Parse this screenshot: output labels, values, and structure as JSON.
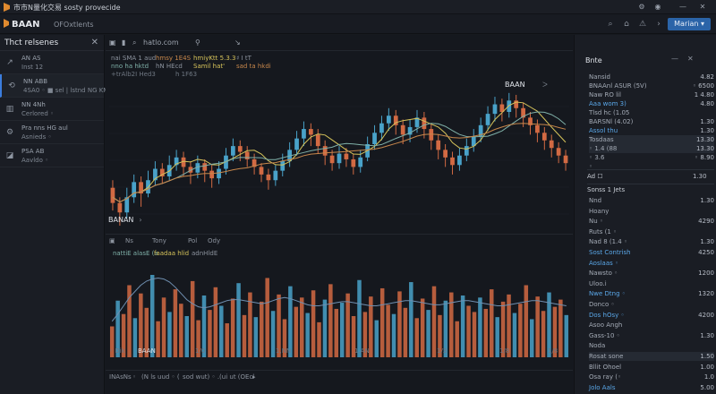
{
  "titlebar": {
    "title": "市市N量化交易 sosty provecide",
    "controls": [
      "⚙",
      "◉",
      "—",
      "✕"
    ]
  },
  "header": {
    "brand": "BAAN",
    "subtitle": "OFOxtlents",
    "right_button": "Marian ▾"
  },
  "left": {
    "panel_title": "Thct relsenes",
    "close": "✕",
    "items": [
      {
        "icon": "↗",
        "l1": "AN AS",
        "l2": "Inst 12"
      },
      {
        "icon": "⟲",
        "l1": "NN ABB",
        "l2": "4SA0 ◦ ■ sel | lstnd NG KMI"
      },
      {
        "icon": "▥",
        "l1": "NN 4Nh",
        "l2": "Cerlored ◦"
      },
      {
        "icon": "⚙",
        "l1": "Pra nns HG aul",
        "l2": "Asnieds ◦"
      },
      {
        "icon": "◪",
        "l1": "PSA AB",
        "l2": "Aavldo ◦"
      }
    ]
  },
  "toolbar": {
    "items": [
      "▣",
      "▮",
      "⌕",
      "hatlo.com",
      "⚲",
      "↘"
    ]
  },
  "indicators": {
    "row1": [
      "nai SMA 1 aud",
      "hmsy 1E4S",
      "hmiyKtt 5.3.3",
      "♯ I tT"
    ],
    "row2": [
      "nno ha hktd",
      "hN HEcd",
      "Samil hat'",
      "sad ta hkdi"
    ],
    "row3": [
      "+trAlb2I Hed3",
      "h 1F63"
    ]
  },
  "chart_symbol": "BAAN",
  "chart_symbol_sub": "ᐳ",
  "main_symbol": "BANAN",
  "sub_toolbar": [
    "▣",
    "Ns",
    "Tony",
    "Pol",
    "Ody"
  ],
  "volume_labels": [
    "nattiE alasE (a",
    "faadaa hlid",
    "adnHldE"
  ],
  "xaxis": [
    "◦ Dik",
    "BAAN",
    "1/0",
    "1,NN",
    "1.AN",
    "1/3",
    "1/8",
    "1/8"
  ],
  "bottom": [
    "INAsNs",
    "◦",
    "(N ls uud ◦ (",
    "sod wut) ◦ .(ui ut (OEcl",
    "▸"
  ],
  "right": {
    "head": "Bnte",
    "rows": [
      {
        "k": "Nansid",
        "v": "4.82",
        "c": ""
      },
      {
        "k": "BNAAnl ASUR (5V)",
        "v": "◦ 6500",
        "c": ""
      },
      {
        "k": "Naw RO lil",
        "v": "1 4.80",
        "c": ""
      },
      {
        "k": "Aaa wom 3)",
        "v": "4.80",
        "c": "blue"
      },
      {
        "k": "Tlsd hc (1.05",
        "v": "",
        "c": ""
      },
      {
        "k": "BARSNl (4.02)",
        "v": "1.30",
        "c": ""
      },
      {
        "k": "Assol thu",
        "v": "1.30",
        "c": "blue"
      },
      {
        "k": "Tosdaas",
        "v": "13.30",
        "c": "hi"
      },
      {
        "k": "◦ 1.4 (88",
        "v": "13.30",
        "c": "hi"
      },
      {
        "k": "◦ 3.6",
        "v": "◦ 8.90",
        "c": ""
      },
      {
        "k": "◦",
        "v": "",
        "c": ""
      }
    ],
    "sec1": "Ad ☐",
    "sec1_val": "1.30",
    "sec2": "Sonss 1 Jets",
    "rows2": [
      {
        "k": "Nnd",
        "v": "1.30",
        "c": ""
      },
      {
        "k": "Hoany",
        "v": "",
        "c": ""
      },
      {
        "k": "Nu ◦",
        "v": "4290",
        "c": ""
      },
      {
        "k": "Ruts (1 ◦",
        "v": "",
        "c": ""
      },
      {
        "k": "Nad 8 (1.4 ◦",
        "v": "1.30",
        "c": ""
      },
      {
        "k": "Sost Contrish",
        "v": "4250",
        "c": "blue"
      },
      {
        "k": "Aoslaas ◦",
        "v": "",
        "c": "blue"
      },
      {
        "k": "Nawsto ◦",
        "v": "1200",
        "c": ""
      },
      {
        "k": "Uloo.i",
        "v": "",
        "c": ""
      },
      {
        "k": "Nwe Dtng ◦",
        "v": "1320",
        "c": "blue"
      },
      {
        "k": "Donco ◦",
        "v": "",
        "c": ""
      },
      {
        "k": "Dos hOsy ◦",
        "v": "4200",
        "c": "blue"
      },
      {
        "k": "Asoo Angh",
        "v": "",
        "c": ""
      },
      {
        "k": "Gass-10 ◦",
        "v": "1.30",
        "c": ""
      },
      {
        "k": "Noda",
        "v": "",
        "c": ""
      },
      {
        "k": "Rosat sone",
        "v": "1.50",
        "c": "hi"
      },
      {
        "k": "Bllit Ohoel",
        "v": "1.00",
        "c": ""
      },
      {
        "k": "Osa ray (◦",
        "v": "1.0",
        "c": ""
      },
      {
        "k": "Jolo Aals",
        "v": "5.00",
        "c": "blue"
      }
    ]
  },
  "colors": {
    "up": "#49a2c9",
    "down": "#d26a43",
    "ma1": "#d6c35a",
    "ma2": "#7fb0a8",
    "ma3": "#c7874b"
  },
  "chart_data": [
    {
      "type": "candlestick",
      "title": "",
      "candles": [
        {
          "o": 38,
          "c": 30,
          "h": 42,
          "l": 26
        },
        {
          "o": 30,
          "c": 25,
          "h": 33,
          "l": 18
        },
        {
          "o": 25,
          "c": 33,
          "h": 38,
          "l": 22
        },
        {
          "o": 33,
          "c": 41,
          "h": 45,
          "l": 30
        },
        {
          "o": 41,
          "c": 35,
          "h": 44,
          "l": 28
        },
        {
          "o": 35,
          "c": 42,
          "h": 47,
          "l": 33
        },
        {
          "o": 42,
          "c": 48,
          "h": 52,
          "l": 39
        },
        {
          "o": 48,
          "c": 44,
          "h": 51,
          "l": 40
        },
        {
          "o": 44,
          "c": 50,
          "h": 55,
          "l": 42
        },
        {
          "o": 50,
          "c": 54,
          "h": 58,
          "l": 47
        },
        {
          "o": 54,
          "c": 49,
          "h": 57,
          "l": 44
        },
        {
          "o": 49,
          "c": 46,
          "h": 52,
          "l": 40
        },
        {
          "o": 46,
          "c": 51,
          "h": 55,
          "l": 43
        },
        {
          "o": 51,
          "c": 47,
          "h": 53,
          "l": 41
        },
        {
          "o": 47,
          "c": 43,
          "h": 50,
          "l": 38
        },
        {
          "o": 43,
          "c": 48,
          "h": 52,
          "l": 40
        },
        {
          "o": 48,
          "c": 55,
          "h": 59,
          "l": 45
        },
        {
          "o": 55,
          "c": 60,
          "h": 64,
          "l": 52
        },
        {
          "o": 60,
          "c": 57,
          "h": 63,
          "l": 52
        },
        {
          "o": 57,
          "c": 53,
          "h": 60,
          "l": 49
        },
        {
          "o": 53,
          "c": 49,
          "h": 56,
          "l": 45
        },
        {
          "o": 49,
          "c": 45,
          "h": 51,
          "l": 41
        },
        {
          "o": 45,
          "c": 42,
          "h": 48,
          "l": 37
        },
        {
          "o": 42,
          "c": 47,
          "h": 50,
          "l": 39
        },
        {
          "o": 47,
          "c": 52,
          "h": 56,
          "l": 44
        },
        {
          "o": 52,
          "c": 58,
          "h": 62,
          "l": 49
        },
        {
          "o": 58,
          "c": 64,
          "h": 68,
          "l": 55
        },
        {
          "o": 64,
          "c": 69,
          "h": 73,
          "l": 60
        },
        {
          "o": 69,
          "c": 66,
          "h": 72,
          "l": 60
        },
        {
          "o": 66,
          "c": 60,
          "h": 69,
          "l": 56
        },
        {
          "o": 60,
          "c": 55,
          "h": 63,
          "l": 50
        },
        {
          "o": 55,
          "c": 51,
          "h": 58,
          "l": 47
        },
        {
          "o": 51,
          "c": 56,
          "h": 60,
          "l": 48
        },
        {
          "o": 56,
          "c": 53,
          "h": 59,
          "l": 49
        },
        {
          "o": 53,
          "c": 49,
          "h": 56,
          "l": 45
        },
        {
          "o": 49,
          "c": 54,
          "h": 58,
          "l": 46
        },
        {
          "o": 54,
          "c": 61,
          "h": 65,
          "l": 52
        },
        {
          "o": 61,
          "c": 67,
          "h": 71,
          "l": 58
        },
        {
          "o": 67,
          "c": 72,
          "h": 76,
          "l": 63
        },
        {
          "o": 72,
          "c": 76,
          "h": 80,
          "l": 68
        },
        {
          "o": 76,
          "c": 71,
          "h": 79,
          "l": 66
        },
        {
          "o": 71,
          "c": 66,
          "h": 74,
          "l": 61
        },
        {
          "o": 66,
          "c": 70,
          "h": 74,
          "l": 62
        },
        {
          "o": 70,
          "c": 75,
          "h": 79,
          "l": 67
        },
        {
          "o": 75,
          "c": 69,
          "h": 78,
          "l": 64
        },
        {
          "o": 69,
          "c": 63,
          "h": 72,
          "l": 58
        },
        {
          "o": 63,
          "c": 58,
          "h": 66,
          "l": 53
        },
        {
          "o": 58,
          "c": 54,
          "h": 61,
          "l": 49
        },
        {
          "o": 54,
          "c": 50,
          "h": 57,
          "l": 45
        },
        {
          "o": 50,
          "c": 55,
          "h": 59,
          "l": 47
        },
        {
          "o": 55,
          "c": 60,
          "h": 64,
          "l": 52
        },
        {
          "o": 60,
          "c": 65,
          "h": 69,
          "l": 57
        },
        {
          "o": 65,
          "c": 71,
          "h": 75,
          "l": 62
        },
        {
          "o": 71,
          "c": 77,
          "h": 81,
          "l": 68
        },
        {
          "o": 77,
          "c": 82,
          "h": 86,
          "l": 73
        },
        {
          "o": 82,
          "c": 78,
          "h": 85,
          "l": 73
        },
        {
          "o": 78,
          "c": 84,
          "h": 88,
          "l": 75
        },
        {
          "o": 84,
          "c": 80,
          "h": 87,
          "l": 75
        },
        {
          "o": 80,
          "c": 75,
          "h": 83,
          "l": 70
        },
        {
          "o": 75,
          "c": 71,
          "h": 78,
          "l": 66
        },
        {
          "o": 71,
          "c": 67,
          "h": 74,
          "l": 62
        },
        {
          "o": 67,
          "c": 63,
          "h": 70,
          "l": 58
        },
        {
          "o": 63,
          "c": 59,
          "h": 66,
          "l": 54
        },
        {
          "o": 59,
          "c": 55,
          "h": 62,
          "l": 51
        },
        {
          "o": 55,
          "c": 51,
          "h": 58,
          "l": 47
        }
      ],
      "ylim": [
        10,
        95
      ]
    },
    {
      "type": "bar",
      "title": "",
      "values": [
        30,
        55,
        42,
        70,
        38,
        62,
        48,
        80,
        35,
        58,
        44,
        66,
        52,
        40,
        74,
        36,
        60,
        46,
        68,
        50,
        33,
        57,
        72,
        41,
        63,
        39,
        54,
        77,
        45,
        61,
        37,
        69,
        49,
        58,
        43,
        65,
        34,
        56,
        71,
        47,
        53,
        62,
        40,
        75,
        44,
        59,
        36,
        67,
        51,
        42,
        64,
        48,
        73,
        38,
        57,
        46,
        69,
        41,
        55,
        63,
        35,
        60,
        50,
        44,
        58,
        47,
        66,
        39,
        54,
        61,
        43,
        52,
        70,
        37,
        59,
        45,
        63,
        49,
        56,
        41
      ],
      "line": [
        35,
        42,
        50,
        58,
        64,
        70,
        74,
        76,
        77,
        76,
        73,
        68,
        62,
        56,
        52,
        49,
        48,
        49,
        51,
        53,
        55,
        56,
        56,
        55,
        54,
        53,
        52,
        53,
        55,
        57,
        58,
        57,
        55,
        53,
        51,
        50,
        50,
        51,
        52,
        53,
        54,
        54,
        53,
        52,
        51,
        50,
        50,
        51,
        52,
        53,
        54,
        55,
        55,
        54,
        53,
        52,
        51,
        51,
        52,
        53,
        54,
        55,
        55,
        54,
        53,
        52,
        51,
        50,
        50,
        51,
        52,
        53,
        54,
        55,
        55,
        54,
        53,
        52,
        51,
        50
      ],
      "ylim": [
        0,
        100
      ]
    }
  ]
}
